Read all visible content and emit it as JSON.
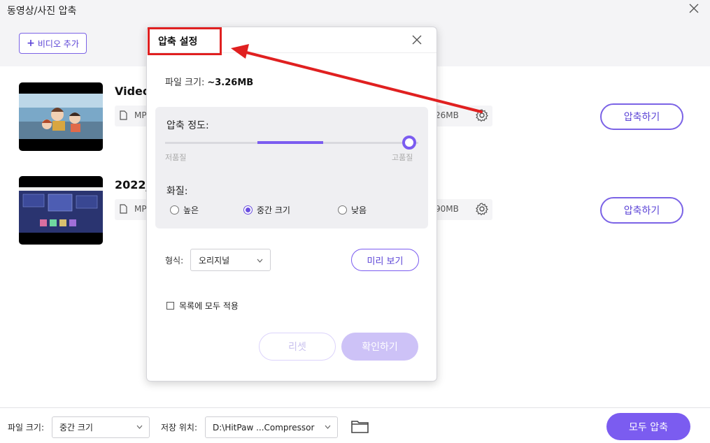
{
  "window": {
    "title": "동영상/사진 압축",
    "add_video_label": "비디오 추가"
  },
  "videos": [
    {
      "name": "Video",
      "format": "MP",
      "size": "26MB",
      "action_label": "압축하기"
    },
    {
      "name": "2022_",
      "format": "MP",
      "size": "90MB",
      "action_label": "압축하기"
    }
  ],
  "dialog": {
    "title": "압축 설정",
    "file_size_label": "파일 크기:",
    "file_size_value": "~3.26MB",
    "compression_level_label": "압축 정도:",
    "compression_level": 1.0,
    "low_quality_label": "저품질",
    "high_quality_label": "고품질",
    "quality_label": "화질:",
    "quality_options": [
      {
        "label": "높은",
        "selected": false
      },
      {
        "label": "중간 크기",
        "selected": true
      },
      {
        "label": "낮음",
        "selected": false
      }
    ],
    "format_label": "형식:",
    "format_value": "오리지널",
    "preview_label": "미리 보기",
    "apply_all_label": "목록에 모두 적용",
    "apply_all_checked": false,
    "reset_label": "리셋",
    "confirm_label": "확인하기"
  },
  "bottom": {
    "file_size_label": "파일 크기:",
    "file_size_value": "중간 크기",
    "save_location_label": "저장 위치:",
    "save_location_value": "D:\\HitPaw ...Compressor",
    "compress_all_label": "모두 압축"
  },
  "colors": {
    "accent": "#7b5cf0",
    "annotation": "#e02020"
  }
}
